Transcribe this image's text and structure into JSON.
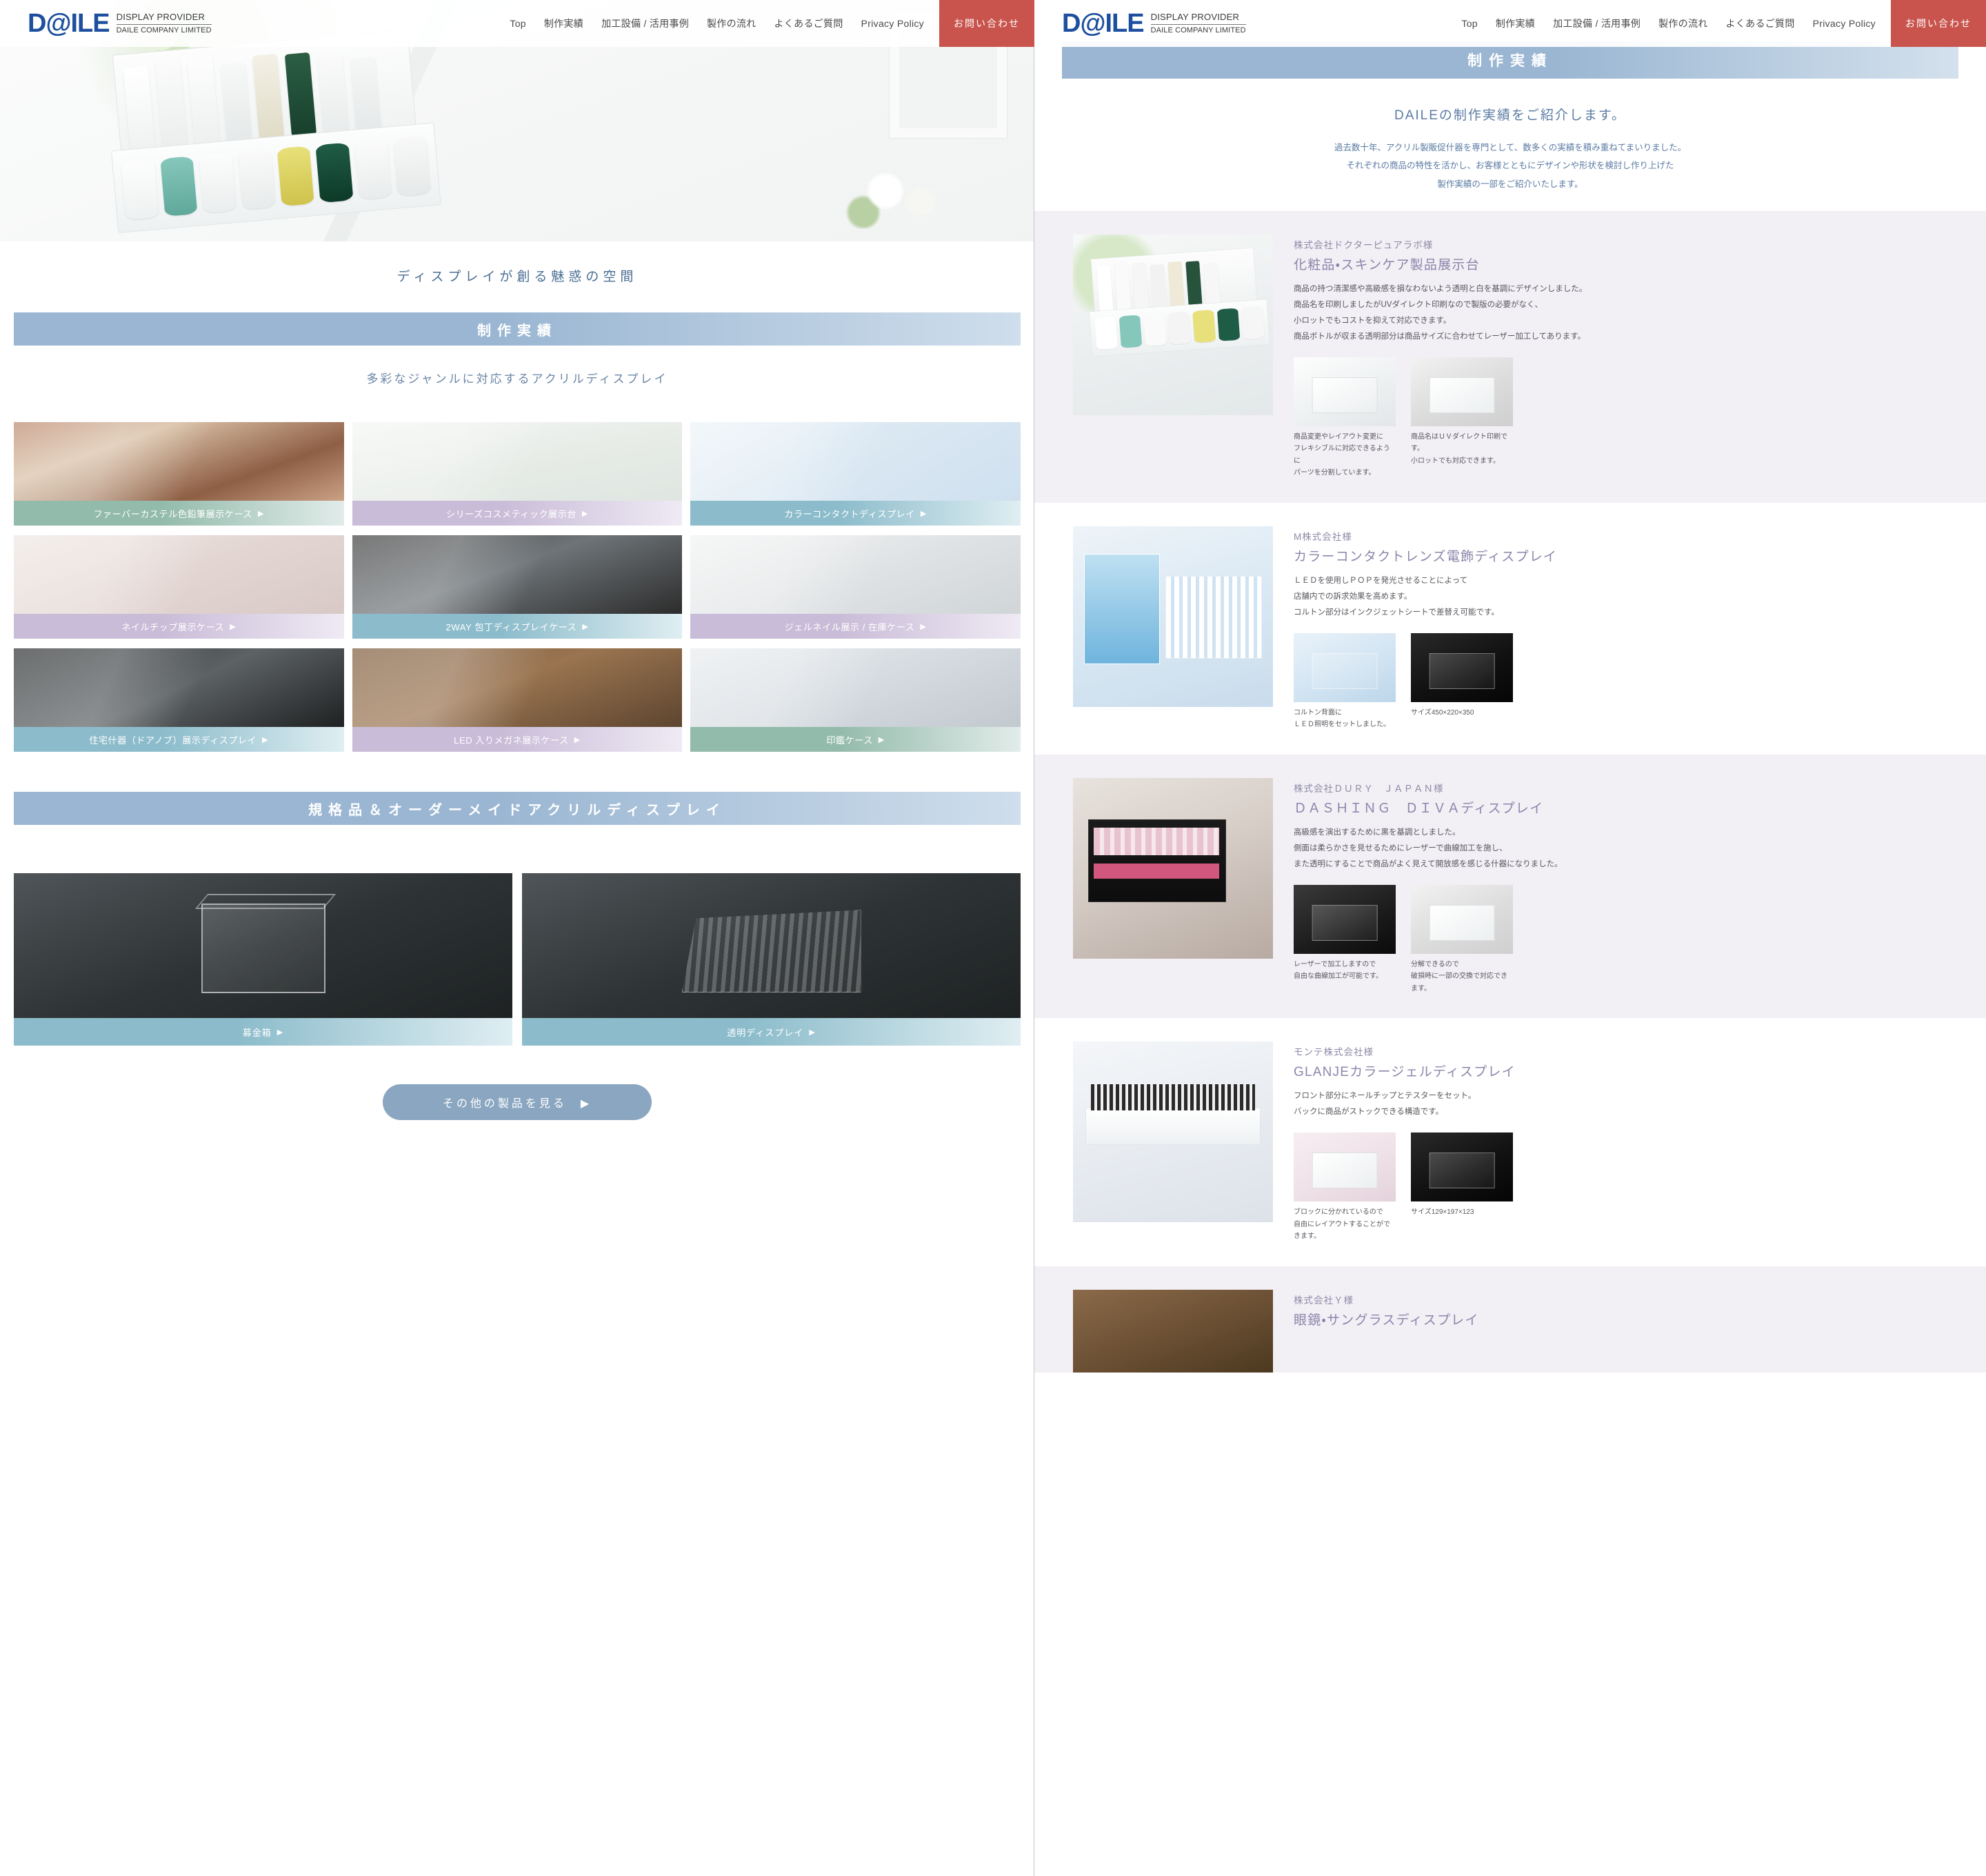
{
  "header": {
    "logo_main": "D@ILE",
    "logo_line1": "DISPLAY PROVIDER",
    "logo_line2": "DAILE COMPANY LIMITED",
    "nav": [
      {
        "label": "Top"
      },
      {
        "label": "制作実績"
      },
      {
        "label": "加工設備 / 活用事例"
      },
      {
        "label": "製作の流れ"
      },
      {
        "label": "よくあるご質問"
      },
      {
        "label": "Privacy Policy"
      }
    ],
    "contact_label": "お問い合わせ",
    "contact_color": "#c9544d"
  },
  "left_page": {
    "tagline": "ディスプレイが創る魅惑の空間",
    "band_title": "制作実績",
    "subtitle": "多彩なジャンルに対応するアクリルディスプレイ",
    "cards": [
      {
        "caption": "ファーバーカステル色鉛筆展示ケース",
        "arrow": "▶",
        "cap_class": "cap-green",
        "img_class": "im1"
      },
      {
        "caption": "シリーズコスメティック展示台",
        "arrow": "▶",
        "cap_class": "cap-purple",
        "img_class": "im2"
      },
      {
        "caption": "カラーコンタクトディスプレイ",
        "arrow": "▶",
        "cap_class": "cap-blue",
        "img_class": "im3"
      },
      {
        "caption": "ネイルチップ展示ケース",
        "arrow": "▶",
        "cap_class": "cap-purple",
        "img_class": "im4"
      },
      {
        "caption": "2WAY 包丁ディスプレイケース",
        "arrow": "▶",
        "cap_class": "cap-blue",
        "img_class": "im5"
      },
      {
        "caption": "ジェルネイル展示 / 在庫ケース",
        "arrow": "▶",
        "cap_class": "cap-purple",
        "img_class": "im6"
      },
      {
        "caption": "住宅什器（ドアノブ）展示ディスプレイ",
        "arrow": "▶",
        "cap_class": "cap-blue",
        "img_class": "im7"
      },
      {
        "caption": "LED 入りメガネ展示ケース",
        "arrow": "▶",
        "cap_class": "cap-purple",
        "img_class": "im8"
      },
      {
        "caption": "印鑑ケース",
        "arrow": "▶",
        "cap_class": "cap-green",
        "img_class": "im9"
      }
    ],
    "band2_title": "規格品＆オーダーメイドアクリルディスプレイ",
    "big_items": [
      {
        "caption": "募金箱",
        "arrow": "▶",
        "cap_class": "cap-blue",
        "shape": "box"
      },
      {
        "caption": "透明ディスプレイ",
        "arrow": "▶",
        "cap_class": "cap-blue",
        "shape": "tier"
      }
    ],
    "more_button": "その他の製品を見る　▶"
  },
  "right_page": {
    "band_title": "制作実績",
    "lead": "DAILEの制作実績をご紹介します。",
    "desc_lines": [
      "過去数十年、アクリル製販促什器を専門として、数多くの実績を積み重ねてまいりました。",
      "それぞれの商品の特性を活かし、お客様とともにデザインや形状を検討し作り上げた",
      "製作実績の一部をご紹介いたします。"
    ],
    "cases": [
      {
        "client": "株式会社ドクターピュアラボ様",
        "title": "化粧品・スキンケア製品展示台",
        "text_lines": [
          "商品の持つ清潔感や高級感を損なわないよう透明と白を基調にデザインしました。",
          "商品名を印刷しましたがUVダイレクト印刷なので製版の必要がなく、",
          "小ロットでもコストを抑えて対応できます。",
          "商品ボトルが収まる透明部分は商品サイズに合わせてレーザー加工してあります。"
        ],
        "photo_class": "cp1",
        "tint": true,
        "thumbs": [
          {
            "caption_lines": [
              "商品変更やレイアウト変更に",
              "フレキシブルに対応できるように",
              "パーツを分割しています。"
            ],
            "img_class": "tp-white",
            "obj": "solid"
          },
          {
            "caption_lines": [
              "商品名はＵＶダイレクト印刷です。",
              "小ロットでも対応できます。"
            ],
            "img_class": "tp-grey",
            "obj": "solid"
          }
        ]
      },
      {
        "client": "M株式会社様",
        "title": "カラーコンタクトレンズ電飾ディスプレイ",
        "text_lines": [
          "ＬＥＤを使用しＰＯＰを発光させることによって",
          "店舗内での訴求効果を高めます。",
          "コルトン部分はインクジェットシートで差替え可能です。"
        ],
        "photo_class": "cp2",
        "tint": false,
        "thumbs": [
          {
            "caption_lines": [
              "コルトン背面に",
              "ＬＥＤ照明をセットしました。"
            ],
            "img_class": "tp-blue",
            "obj": "solid"
          },
          {
            "caption_lines": [
              "サイズ450×220×350"
            ],
            "img_class": "tp-black",
            "obj": "dark"
          }
        ]
      },
      {
        "client": "株式会社ＤＵＲＹ　ＪＡＰＡＮ様",
        "title": "ＤＡＳＨＩＮＧ　ＤＩＶＡディスプレイ",
        "text_lines": [
          "高級感を演出するために黒を基調としました。",
          "側面は柔らかさを見せるためにレーザーで曲線加工を施し、",
          "また透明にすることで商品がよく見えて開放感を感じる什器になりました。"
        ],
        "photo_class": "cp3",
        "tint": true,
        "thumbs": [
          {
            "caption_lines": [
              "レーザーで加工しますので",
              "自由な曲線加工が可能です。"
            ],
            "img_class": "tp-dark",
            "obj": "dark"
          },
          {
            "caption_lines": [
              "分解できるので",
              "破損時に一部の交換で対応できます。"
            ],
            "img_class": "tp-grey",
            "obj": "solid"
          }
        ]
      },
      {
        "client": "モンテ株式会社様",
        "title": "GLANJEカラージェルディスプレイ",
        "text_lines": [
          "フロント部分にネールチップとテスターをセット。",
          "バックに商品がストックできる構造です。"
        ],
        "photo_class": "cp4",
        "tint": false,
        "thumbs": [
          {
            "caption_lines": [
              "ブロックに分かれているので",
              "自由にレイアウトすることができます。"
            ],
            "img_class": "tp-pink",
            "obj": "solid"
          },
          {
            "caption_lines": [
              "サイズ129×197×123"
            ],
            "img_class": "tp-black",
            "obj": "dark"
          }
        ]
      },
      {
        "client": "株式会社Ｙ様",
        "title": "眼鏡・サングラスディスプレイ",
        "text_lines": [],
        "photo_class": "cp5",
        "tint": true,
        "thumbs": []
      }
    ]
  }
}
